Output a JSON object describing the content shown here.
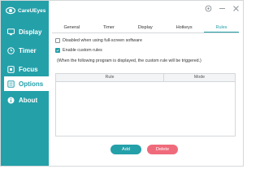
{
  "app": {
    "name": "CareUEyes"
  },
  "colors": {
    "accent": "#24a0a9",
    "danger": "#ef6b7c",
    "sidebar": "#24a0a9"
  },
  "sidebar": {
    "items": [
      {
        "label": "Display",
        "icon": "monitor-icon",
        "active": false
      },
      {
        "label": "Timer",
        "icon": "clock-icon",
        "active": false
      },
      {
        "label": "Focus",
        "icon": "focus-icon",
        "active": false
      },
      {
        "label": "Options",
        "icon": "options-icon",
        "active": true
      },
      {
        "label": "About",
        "icon": "info-icon",
        "active": false
      }
    ]
  },
  "window_controls": [
    "settings-icon",
    "minimize-icon",
    "close-icon"
  ],
  "tabs": [
    {
      "label": "General",
      "active": false
    },
    {
      "label": "Timer",
      "active": false
    },
    {
      "label": "Display",
      "active": false
    },
    {
      "label": "Hotkeys",
      "active": false
    },
    {
      "label": "Rules",
      "active": true
    }
  ],
  "options": {
    "disabled_fullscreen": {
      "label": "Disabled when using full-screen software",
      "checked": false
    },
    "enable_custom_rules": {
      "label": "Enable custom rules",
      "checked": true
    }
  },
  "note": "(When the following program is displayed, the custom rule will be triggered.)",
  "table": {
    "columns": [
      "Rule",
      "Mode"
    ],
    "rows": []
  },
  "buttons": {
    "add": "Add",
    "delete": "Delete"
  }
}
